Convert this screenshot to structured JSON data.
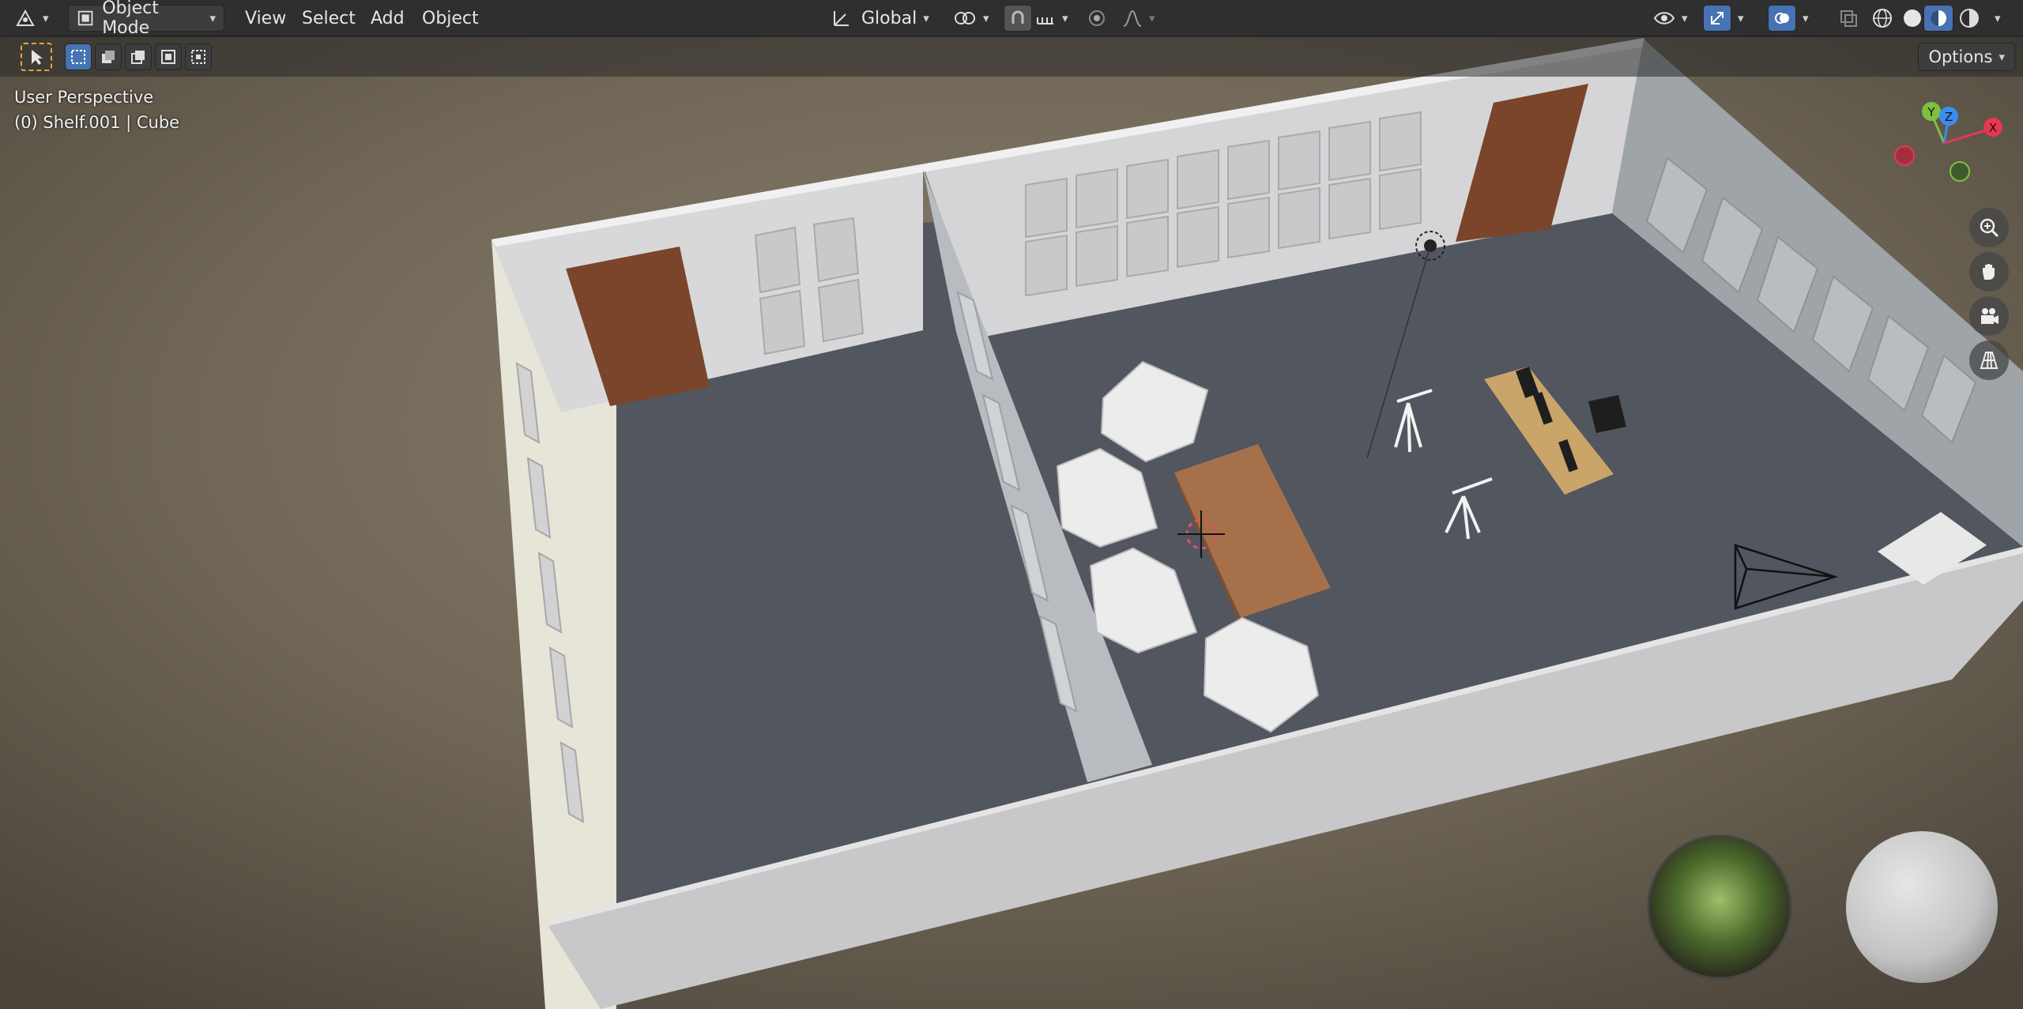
{
  "header": {
    "mode_label": "Object Mode",
    "menus": [
      "View",
      "Select",
      "Add",
      "Object"
    ],
    "transform_orientation": "Global",
    "options_label": "Options"
  },
  "viewport": {
    "view_name": "User Perspective",
    "active_object": "(0) Shelf.001 | Cube"
  },
  "gizmo": {
    "y_label": "Y",
    "z_label": "Z",
    "x_label": "X"
  },
  "icons": [
    "editor-type-icon",
    "object-mode-icon",
    "transform-orientation-icon",
    "pivot-icon",
    "snap-icon",
    "snap-increment-icon",
    "proportional-edit-icon",
    "falloff-icon",
    "visibility-icon",
    "gizmo-icon",
    "overlay-icon",
    "xray-icon",
    "wireframe-shading-icon",
    "solid-shading-icon",
    "material-shading-icon",
    "rendered-shading-icon",
    "select-tool-icon",
    "zoom-icon",
    "pan-hand-icon",
    "camera-icon",
    "grid-icon"
  ],
  "colors": {
    "accent_blue": "#4772b3",
    "axis_x": "#e8374f",
    "axis_y": "#7fbf3f",
    "axis_z": "#3c8cf0"
  }
}
